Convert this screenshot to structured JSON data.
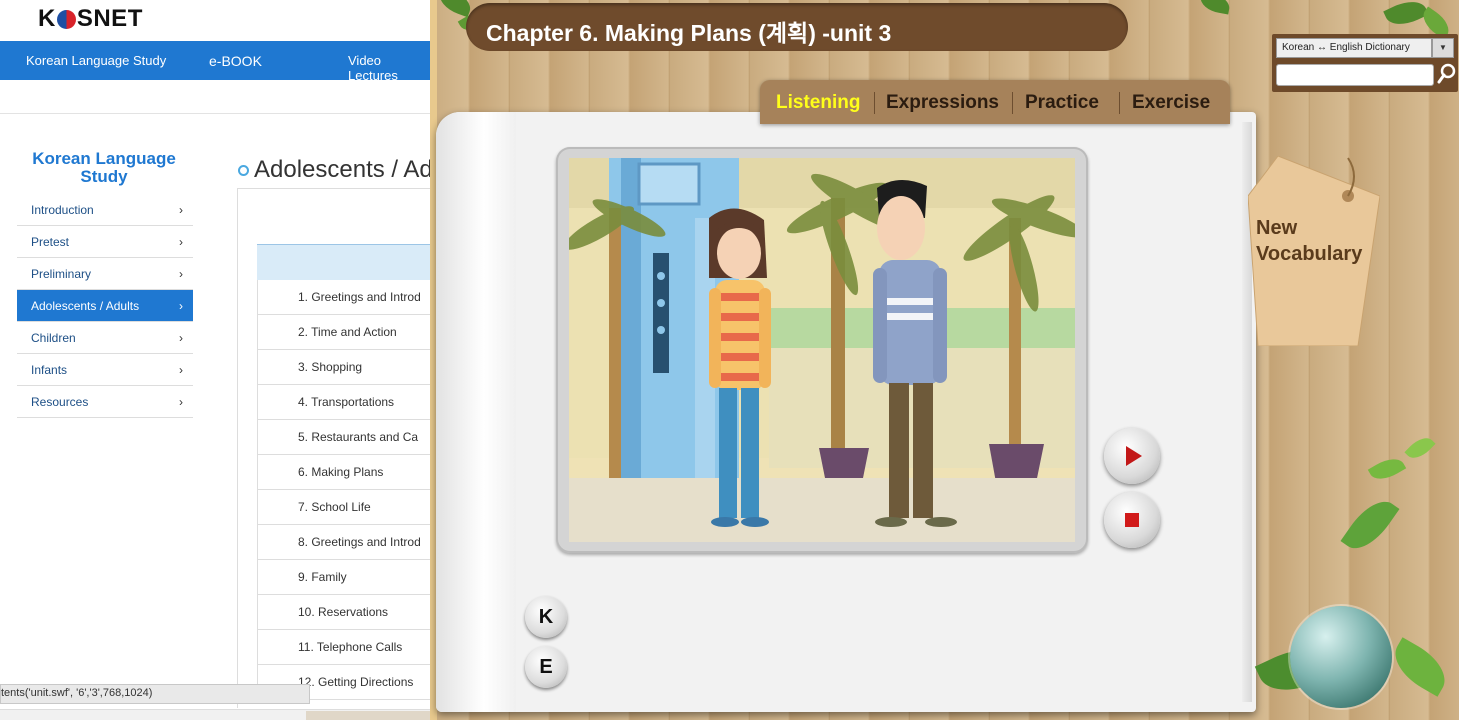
{
  "browser": {
    "logo": "KOSNET",
    "top_nav": [
      "Korean Language Study",
      "e-BOOK",
      "Video Lectures"
    ],
    "sidebar": {
      "title": "Korean Language Study",
      "items": [
        {
          "label": "Introduction",
          "active": false
        },
        {
          "label": "Pretest",
          "active": false
        },
        {
          "label": "Preliminary",
          "active": false
        },
        {
          "label": "Adolescents / Adults",
          "active": true
        },
        {
          "label": "Children",
          "active": false
        },
        {
          "label": "Infants",
          "active": false
        },
        {
          "label": "Resources",
          "active": false
        }
      ]
    },
    "page_title": "Adolescents / Ad",
    "lessons": [
      "1. Greetings and Introd",
      "2. Time and Action",
      "3. Shopping",
      "4. Transportations",
      "5. Restaurants and Ca",
      "6. Making Plans",
      "7. School Life",
      "8. Greetings and Introd",
      "9. Family",
      "10. Reservations",
      "11. Telephone Calls",
      "12. Getting Directions"
    ],
    "status_text": "tents('unit.swf', '6','3',768,1024)"
  },
  "flash": {
    "chapter_title": "Chapter 6. Making Plans (계획) -unit 3",
    "dictionary": {
      "selected": "Korean ↔ English Dictionary",
      "search_value": ""
    },
    "tabs": [
      {
        "label": "Listening",
        "active": true
      },
      {
        "label": "Expressions",
        "active": false
      },
      {
        "label": "Practice",
        "active": false
      },
      {
        "label": "Exercise",
        "active": false
      }
    ],
    "vocab_tag": {
      "line1": "New",
      "line2": "Vocabulary"
    },
    "lang_buttons": [
      "K",
      "E"
    ],
    "colors": {
      "accent_tab": "#ffff1a",
      "web_blue": "#1f78d1",
      "wood": "#c9ab7f"
    }
  }
}
